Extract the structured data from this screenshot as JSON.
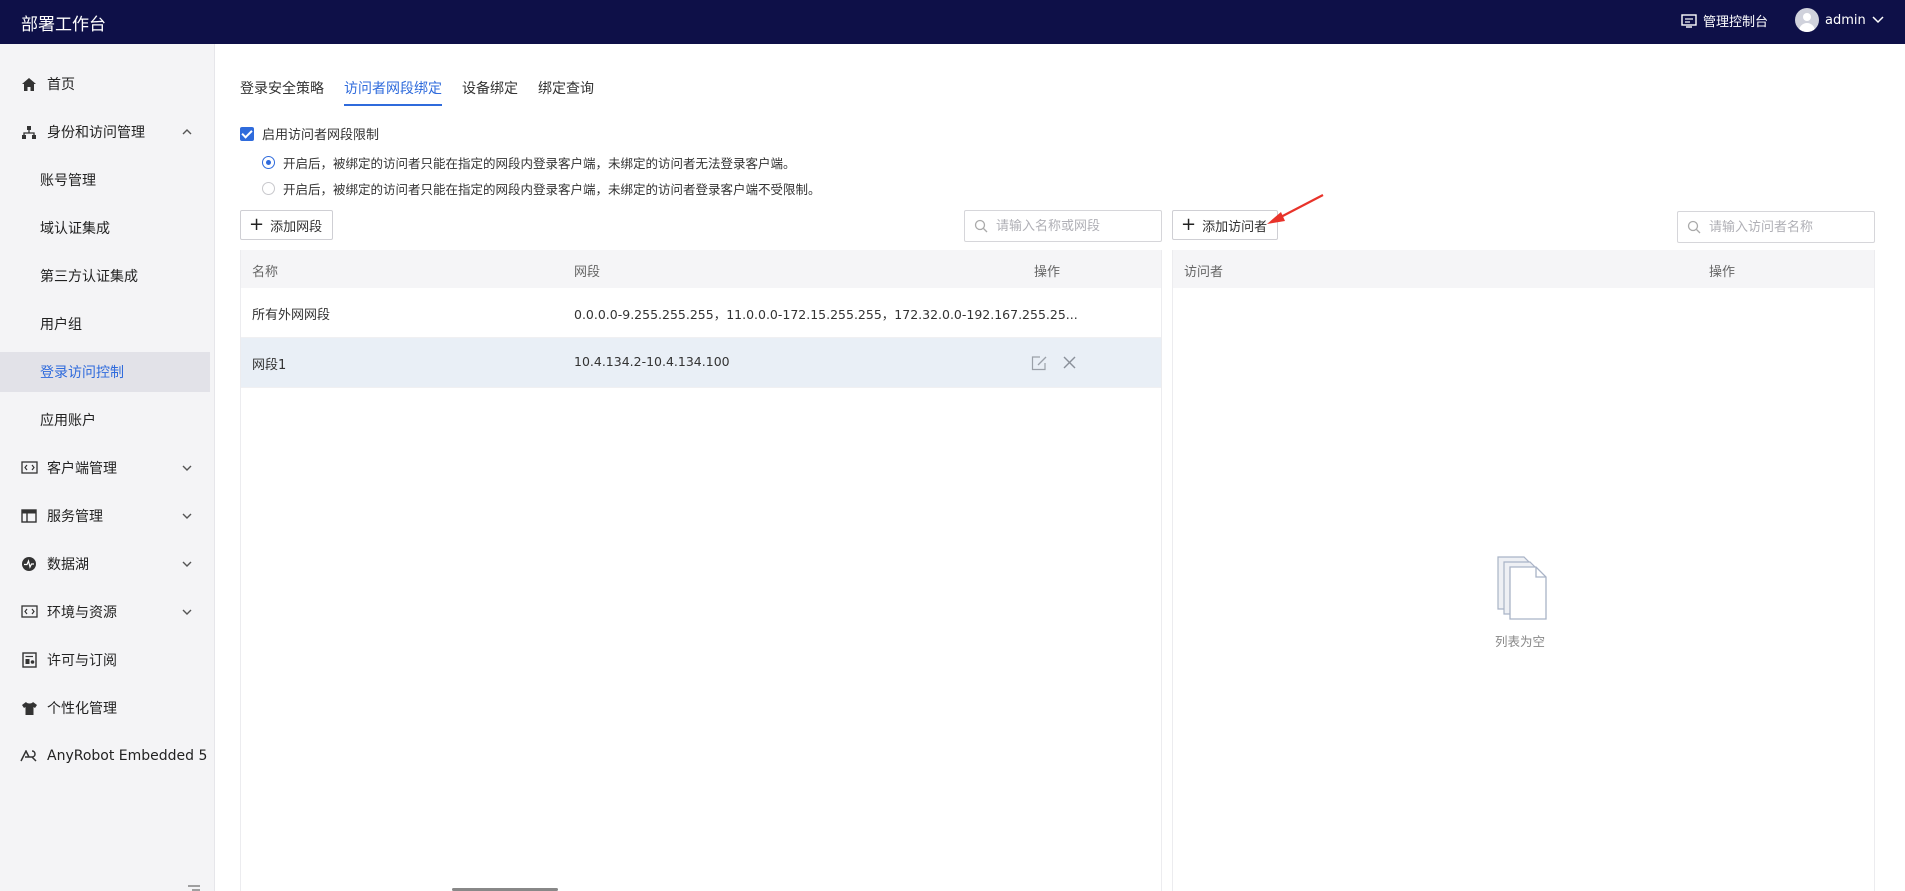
{
  "header": {
    "app_title": "部署工作台",
    "console_label": "管理控制台",
    "username": "admin"
  },
  "sidebar": {
    "items": [
      {
        "label": "首页",
        "icon": "home-icon"
      },
      {
        "label": "身份和访问管理",
        "icon": "org-icon",
        "expanded": true
      },
      {
        "label": "账号管理"
      },
      {
        "label": "域认证集成"
      },
      {
        "label": "第三方认证集成"
      },
      {
        "label": "用户组"
      },
      {
        "label": "登录访问控制",
        "active": true
      },
      {
        "label": "应用账户"
      },
      {
        "label": "客户端管理",
        "icon": "code-icon"
      },
      {
        "label": "服务管理",
        "icon": "layout-icon"
      },
      {
        "label": "数据湖",
        "icon": "pulse-icon"
      },
      {
        "label": "环境与资源",
        "icon": "code-icon"
      },
      {
        "label": "许可与订阅",
        "icon": "license-icon"
      },
      {
        "label": "个性化管理",
        "icon": "shirt-icon"
      },
      {
        "label": "AnyRobot Embedded 5",
        "icon": "anyrobot-logo-icon"
      }
    ]
  },
  "tabs": [
    {
      "label": "登录安全策略"
    },
    {
      "label": "访问者网段绑定",
      "active": true
    },
    {
      "label": "设备绑定"
    },
    {
      "label": "绑定查询"
    }
  ],
  "restriction": {
    "checkbox_label": "启用访问者网段限制",
    "checked": true,
    "options": [
      {
        "label": "开启后，被绑定的访问者只能在指定的网段内登录客户端，未绑定的访问者无法登录客户端。",
        "selected": true
      },
      {
        "label": "开启后，被绑定的访问者只能在指定的网段内登录客户端，未绑定的访问者登录客户端不受限制。",
        "selected": false
      }
    ]
  },
  "segments": {
    "add_label": "添加网段",
    "search_placeholder": "请输入名称或网段",
    "columns": [
      "名称",
      "网段",
      "操作"
    ],
    "rows": [
      {
        "name": "所有外网网段",
        "range": "0.0.0.0-9.255.255.255，11.0.0.0-172.15.255.255，172.32.0.0-192.167.255.25..."
      },
      {
        "name": "网段1",
        "range": "10.4.134.2-10.4.134.100",
        "selected": true
      }
    ]
  },
  "visitors": {
    "add_label": "添加访问者",
    "search_placeholder": "请输入访问者名称",
    "columns": [
      "访问者",
      "操作"
    ],
    "empty_text": "列表为空"
  },
  "colors": {
    "topbar": "#0e1048",
    "accent": "#2f6bdc",
    "annotation_arrow": "#e8332a"
  }
}
